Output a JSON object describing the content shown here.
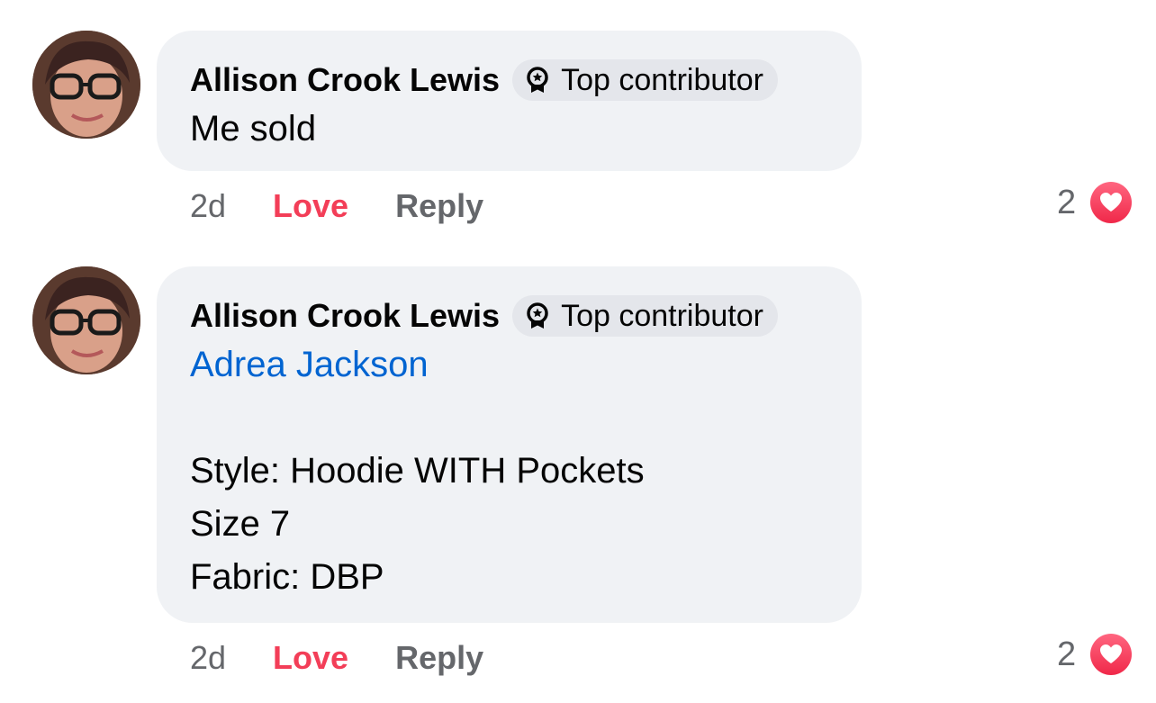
{
  "comments": [
    {
      "author": "Allison Crook Lewis",
      "badge": "Top contributor",
      "mention": "",
      "lines": [
        "Me sold"
      ],
      "time": "2d",
      "love_label": "Love",
      "reply_label": "Reply",
      "reaction_count": "2",
      "reaction_icon": "heart-icon"
    },
    {
      "author": "Allison Crook Lewis",
      "badge": "Top contributor",
      "mention": "Adrea Jackson",
      "lines": [
        "Style: Hoodie WITH Pockets",
        "Size 7",
        "Fabric: DBP"
      ],
      "time": "2d",
      "love_label": "Love",
      "reply_label": "Reply",
      "reaction_count": "2",
      "reaction_icon": "heart-icon"
    }
  ],
  "colors": {
    "bubble": "#f0f2f5",
    "badge": "#e4e6eb",
    "mention": "#0064d1",
    "love": "#f33e58",
    "muted": "#65676b"
  }
}
